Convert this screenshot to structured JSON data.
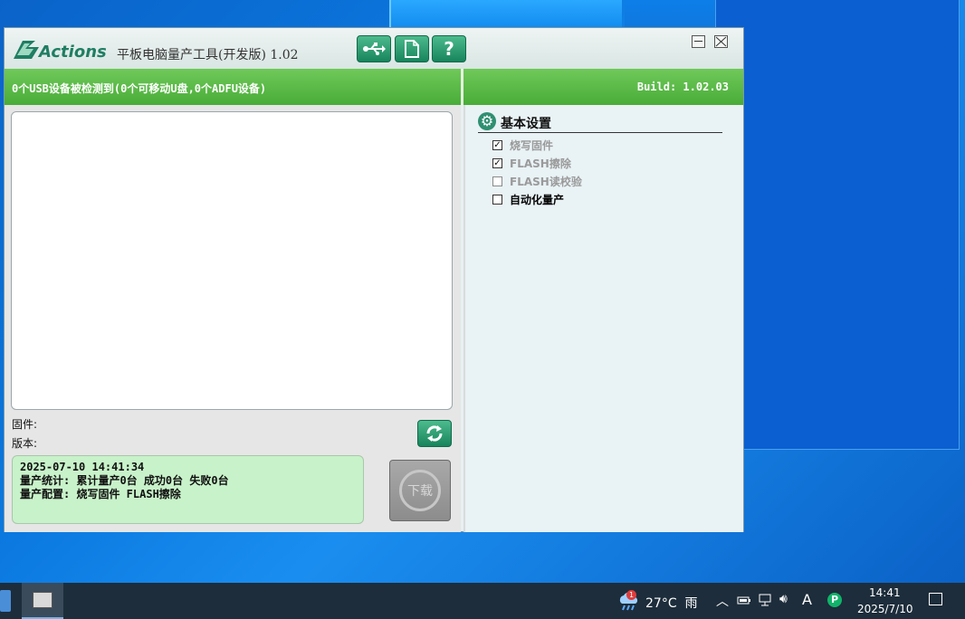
{
  "window": {
    "brand": "Actions",
    "title": "平板电脑量产工具(开发版) 1.02",
    "toolbar": {
      "usb_icon": "usb-icon",
      "doc_icon": "document-icon",
      "help_label": "?"
    },
    "status": {
      "left": "0个USB设备被检测到(0个可移动U盘,0个ADFU设备)",
      "right": "Build: 1.02.03"
    },
    "firmware_label": "固件:",
    "version_label": "版本:",
    "log": {
      "line1": "2025-07-10 14:41:34",
      "line2": "量产统计: 累计量产0台 成功0台 失败0台",
      "line3": "量产配置: 烧写固件 FLASH擦除"
    },
    "download_label": "下载",
    "settings": {
      "title": "基本设置",
      "options": [
        {
          "label": "烧写固件",
          "checked": true,
          "enabled": false
        },
        {
          "label": "FLASH擦除",
          "checked": true,
          "enabled": false
        },
        {
          "label": "FLASH读校验",
          "checked": false,
          "enabled": false
        },
        {
          "label": "自动化量产",
          "checked": false,
          "enabled": true
        }
      ]
    }
  },
  "taskbar": {
    "weather_badge": "1",
    "temperature": "27°C",
    "weather": "雨",
    "ime": "A",
    "time": "14:41",
    "date": "2025/7/10"
  }
}
